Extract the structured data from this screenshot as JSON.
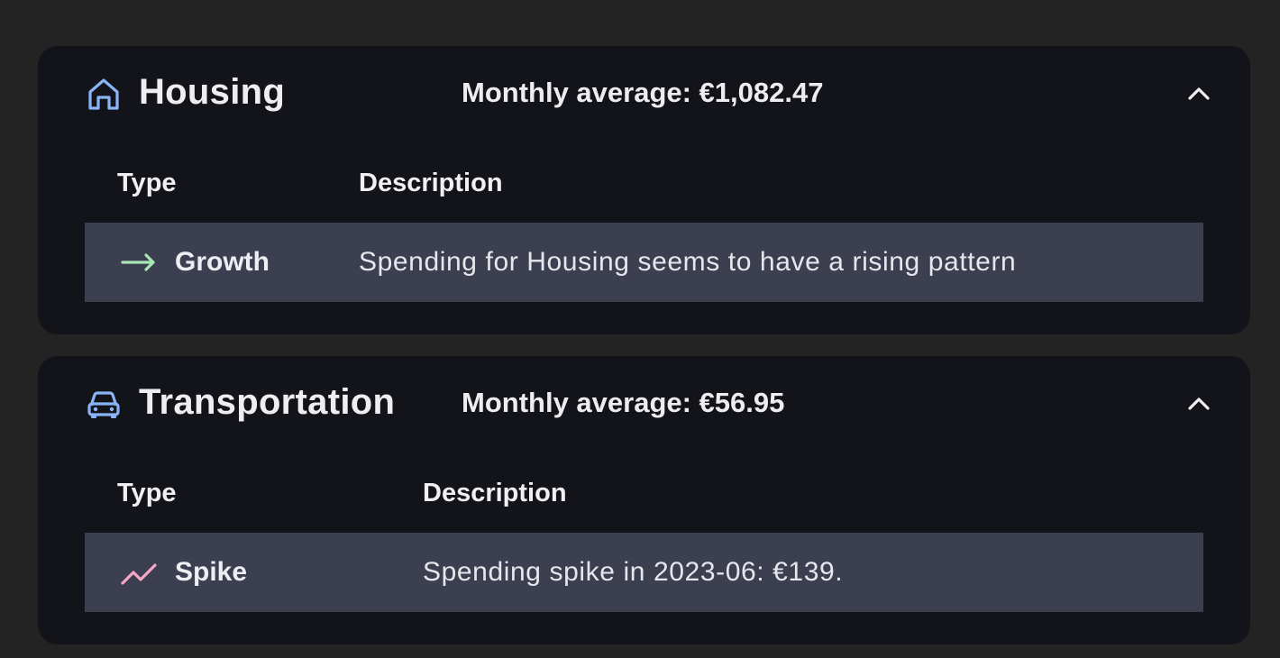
{
  "colors": {
    "background": "#232323",
    "card": "#131419",
    "row": "#3b3f4f",
    "category_icon": "#8ab4f8",
    "growth_icon": "#a8e6b4",
    "spike_icon": "#f4a7c7"
  },
  "categories": [
    {
      "title": "Housing",
      "icon": "house-icon",
      "monthly_average": "Monthly average: €1,082.47",
      "table": {
        "header_type": "Type",
        "header_description": "Description",
        "rows": [
          {
            "type": "Growth",
            "type_icon": "arrow-right-icon",
            "description": "Spending for Housing seems to have a rising pattern"
          }
        ]
      }
    },
    {
      "title": "Transportation",
      "icon": "car-icon",
      "monthly_average": "Monthly average: €56.95",
      "table": {
        "header_type": "Type",
        "header_description": "Description",
        "rows": [
          {
            "type": "Spike",
            "type_icon": "trending-up-icon",
            "description": "Spending spike in 2023-06: €139."
          }
        ]
      }
    }
  ]
}
